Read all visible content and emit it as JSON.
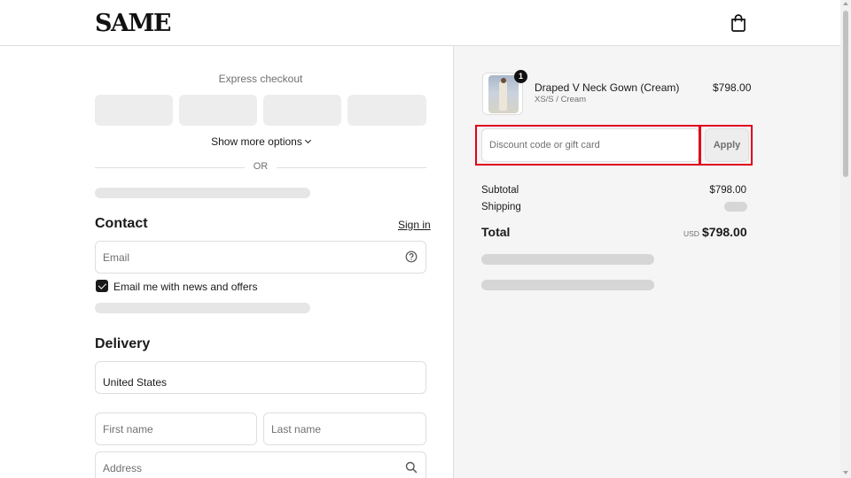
{
  "header": {
    "logo": "SAME",
    "cart_icon": "shopping-bag-icon"
  },
  "express": {
    "title": "Express checkout",
    "show_more": "Show more options",
    "divider": "OR"
  },
  "contact": {
    "title": "Contact",
    "signin": "Sign in",
    "email_placeholder": "Email",
    "email_help_icon": "question-circle-icon",
    "newsletter_label": "Email me with news and offers",
    "newsletter_checked": true
  },
  "delivery": {
    "title": "Delivery",
    "country_value": "United States",
    "first_name_placeholder": "First name",
    "last_name_placeholder": "Last name",
    "address_placeholder": "Address",
    "address_icon": "search-icon"
  },
  "summary": {
    "product": {
      "quantity": "1",
      "name": "Draped V Neck Gown (Cream)",
      "variant": "XS/S / Cream",
      "price": "$798.00"
    },
    "discount_placeholder": "Discount code or gift card",
    "apply_label": "Apply",
    "subtotal_label": "Subtotal",
    "subtotal_value": "$798.00",
    "shipping_label": "Shipping",
    "total_label": "Total",
    "total_currency": "USD",
    "total_value": "$798.00"
  },
  "colors": {
    "highlight": "#e0001a",
    "sidebar_bg": "#f5f5f5",
    "text": "#1a1a1a",
    "muted": "#707070"
  }
}
